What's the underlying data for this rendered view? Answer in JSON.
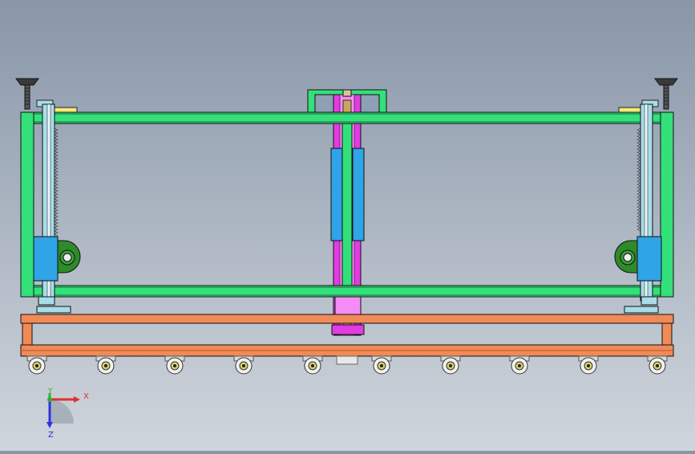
{
  "triad": {
    "x_label": "X",
    "y_label": "Y",
    "z_label": "Z"
  },
  "colors": {
    "frame": "#33e07a",
    "base_frame": "#f08a57",
    "cylinder": "#e33be3",
    "cylinder_sleeve": "#2fa4e6",
    "bearing_block": "#2fa4e6",
    "bearing_housing": "#2f8a2a",
    "rail": "#a8dde8",
    "outline": "#1a1a1a",
    "axis_x": "#e03030",
    "axis_y": "#30b030",
    "axis_z": "#3030e0"
  },
  "casters": {
    "count": 10
  }
}
